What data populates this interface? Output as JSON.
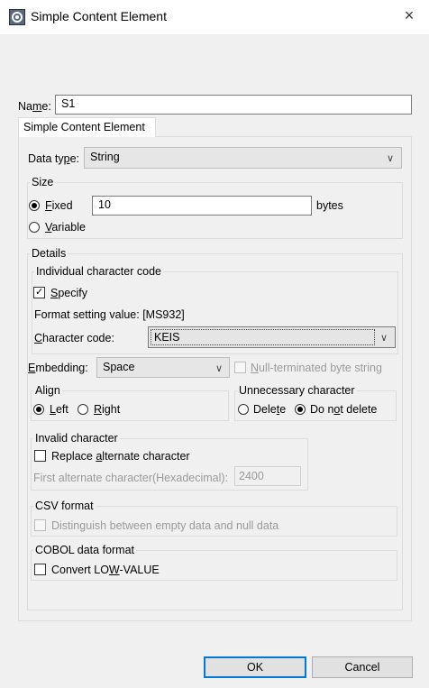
{
  "window": {
    "title": "Simple Content Element",
    "close_symbol": "×"
  },
  "name": {
    "label": "Name:",
    "value": "S1"
  },
  "tab": {
    "label": "Simple Content Element"
  },
  "data_type": {
    "label": "Data type:",
    "value": "String"
  },
  "size": {
    "group_label": "Size",
    "fixed_label": "Fixed",
    "fixed_value": "10",
    "fixed_unit": "bytes",
    "variable_label": "Variable"
  },
  "details": {
    "group_label": "Details",
    "individual_char_code": {
      "group_label": "Individual character code",
      "specify_label": "Specify",
      "format_setting_value": "Format setting value: [MS932]",
      "character_code_label": "Character code:",
      "character_code_value": "KEIS"
    },
    "embedding": {
      "label": "Embedding:",
      "value": "Space"
    },
    "null_terminated_label": "Null-terminated byte string",
    "align": {
      "group_label": "Align",
      "left_label": "Left",
      "right_label": "Right"
    },
    "unnecessary_character": {
      "group_label": "Unnecessary character",
      "delete_label": "Delete",
      "do_not_delete_label": "Do not delete"
    },
    "invalid_character": {
      "group_label": "Invalid character",
      "replace_label": "Replace alternate character",
      "first_alt_label": "First alternate character(Hexadecimal):",
      "first_alt_value": "2400"
    },
    "csv_format": {
      "group_label": "CSV format",
      "distinguish_label": "Distinguish between empty data and null data"
    },
    "cobol_format": {
      "group_label": "COBOL data format",
      "convert_label": "Convert LOW-VALUE"
    }
  },
  "buttons": {
    "ok": "OK",
    "cancel": "Cancel"
  },
  "icons": {
    "app": "app-gear-icon",
    "close": "close-icon",
    "dropdown": "chevron-down-icon"
  },
  "colors": {
    "dialog_bg": "#f0f0f0",
    "focus_border": "#0078d7"
  }
}
